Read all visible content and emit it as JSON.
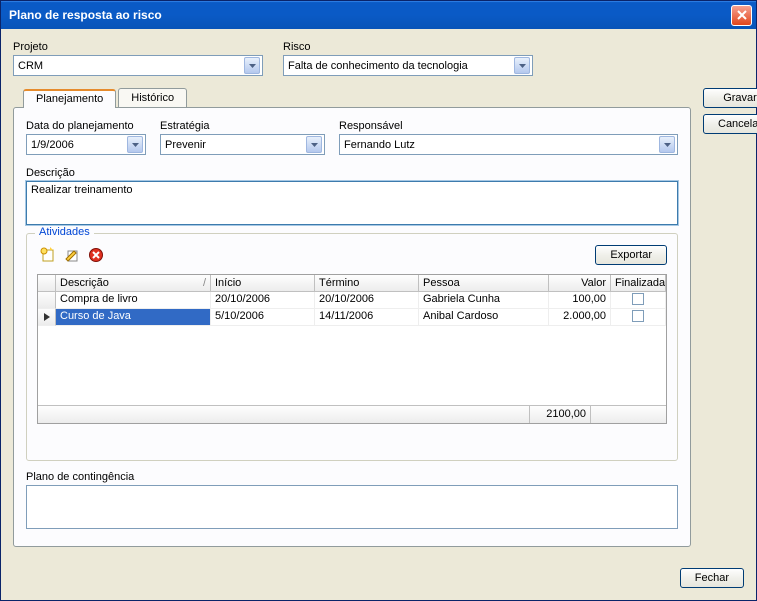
{
  "window": {
    "title": "Plano de resposta ao risco"
  },
  "top": {
    "projeto_label": "Projeto",
    "projeto_value": "CRM",
    "risco_label": "Risco",
    "risco_value": "Falta de conhecimento da tecnologia"
  },
  "tabs": {
    "planejamento": "Planejamento",
    "historico": "Histórico"
  },
  "plan": {
    "data_label": "Data do planejamento",
    "data_value": "1/9/2006",
    "estrategia_label": "Estratégia",
    "estrategia_value": "Prevenir",
    "responsavel_label": "Responsável",
    "responsavel_value": "Fernando Lutz",
    "descricao_label": "Descrição",
    "descricao_value": "Realizar treinamento"
  },
  "activities": {
    "group_label": "Atividades",
    "export_label": "Exportar",
    "headers": {
      "descricao": "Descrição",
      "inicio": "Início",
      "termino": "Término",
      "pessoa": "Pessoa",
      "valor": "Valor",
      "finalizada": "Finalizada"
    },
    "rows": [
      {
        "descricao": "Compra de livro",
        "inicio": "20/10/2006",
        "termino": "20/10/2006",
        "pessoa": "Gabriela Cunha",
        "valor": "100,00",
        "finalizada": false
      },
      {
        "descricao": "Curso de Java",
        "inicio": "5/10/2006",
        "termino": "14/11/2006",
        "pessoa": "Anibal Cardoso",
        "valor": "2.000,00",
        "finalizada": false
      }
    ],
    "sum": "2100,00",
    "selected_index": 1
  },
  "contingencia": {
    "label": "Plano de contingência",
    "value": ""
  },
  "buttons": {
    "gravar": "Gravar",
    "cancelar": "Cancelar",
    "fechar": "Fechar"
  }
}
